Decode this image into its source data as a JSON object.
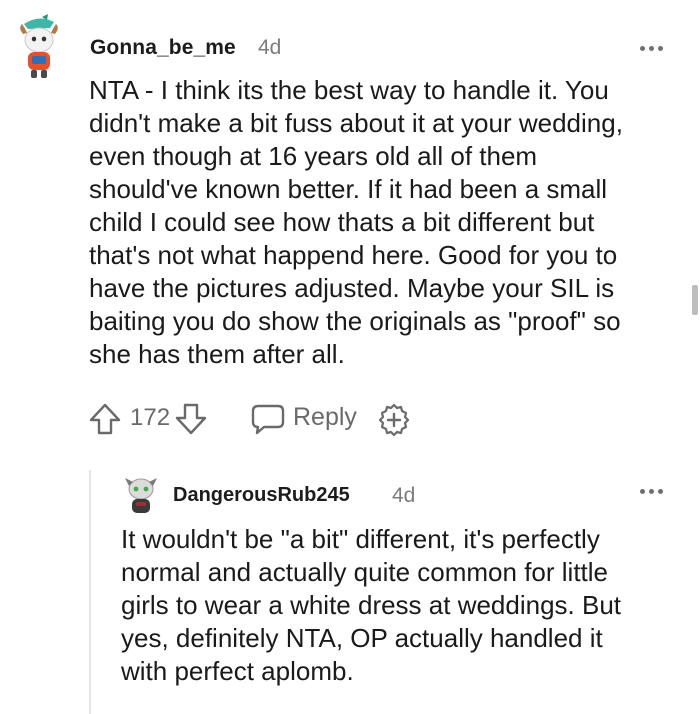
{
  "comment": {
    "username": "Gonna_be_me",
    "age": "4d",
    "lines": [
      "NTA - I think its the best way to handle it. You",
      "didn't make a bit fuss about it at your wedding,",
      "even though at 16 years old all of them",
      "should've known better. If it had been a small",
      "child I could see how thats a bit different but",
      "that's not what happend here. Good for you to",
      "have the pictures adjusted. Maybe your SIL is",
      "baiting you do show the originals as \"proof\" so",
      "she has them after all."
    ],
    "votes": "172",
    "reply_label": "Reply"
  },
  "reply": {
    "username": "DangerousRub245",
    "age": "4d",
    "lines": [
      "It wouldn't be \"a bit\" different, it's perfectly",
      "normal and actually quite common for little",
      "girls to wear a white dress at weddings. But",
      "yes, definitely NTA, OP actually handled it",
      "with perfect aplomb."
    ]
  },
  "icons": {
    "upvote": "upvote-arrow-icon",
    "downvote": "downvote-arrow-icon",
    "reply": "speech-bubble-icon",
    "award": "award-plus-icon",
    "more": "more-options-icon"
  },
  "colors": {
    "text": "#1a1a1b",
    "meta": "#7c7c7c",
    "icon": "#6a6a6a"
  }
}
